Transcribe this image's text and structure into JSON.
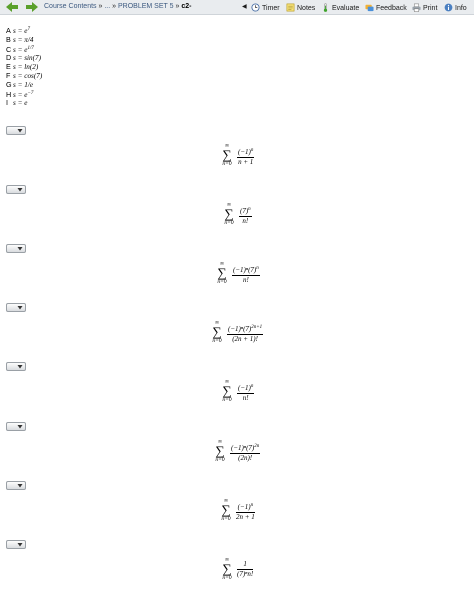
{
  "toolbar": {
    "breadcrumb_link": "Course Contents",
    "breadcrumb_sep1": "»",
    "breadcrumb_ellipsis": "...",
    "breadcrumb_sep2": "»",
    "breadcrumb_parent": "PROBLEM SET 5",
    "breadcrumb_sep3": "»",
    "breadcrumb_current": "c2-",
    "timer_label": "Timer",
    "notes_label": "Notes",
    "evaluate_label": "Evaluate",
    "feedback_label": "Feedback",
    "print_label": "Print",
    "info_label": "Info"
  },
  "options": [
    {
      "letter": "A",
      "lhs": "s = ",
      "base": "e",
      "sup": "7"
    },
    {
      "letter": "B",
      "lhs": "s = ",
      "base": "π/4",
      "sup": ""
    },
    {
      "letter": "C",
      "lhs": "s = ",
      "base": "e",
      "sup": "1/7"
    },
    {
      "letter": "D",
      "lhs": "s = ",
      "base": "sin(7)",
      "sup": ""
    },
    {
      "letter": "E",
      "lhs": "s = ",
      "base": "ln(2)",
      "sup": ""
    },
    {
      "letter": "F",
      "lhs": "s = ",
      "base": "cos(7)",
      "sup": ""
    },
    {
      "letter": "G",
      "lhs": "s = ",
      "base": "1/e",
      "sup": ""
    },
    {
      "letter": "H",
      "lhs": "s = ",
      "base": "e",
      "sup": "−7"
    },
    {
      "letter": "I",
      "lhs": "s = ",
      "base": "e",
      "sup": ""
    }
  ],
  "series": [
    {
      "upper": "∞",
      "lower": "n=0",
      "num": "(−1)",
      "num_sup": "n",
      "den": "n + 1",
      "den_sup": ""
    },
    {
      "upper": "∞",
      "lower": "n=0",
      "num": "(7)",
      "num_sup": "n",
      "den": "n!",
      "den_sup": ""
    },
    {
      "upper": "∞",
      "lower": "n=0",
      "num": "(−1)ⁿ(7)",
      "num_sup": "n",
      "den": "n!",
      "den_sup": ""
    },
    {
      "upper": "∞",
      "lower": "n=0",
      "num": "(−1)ⁿ(7)",
      "num_sup": "2n+1",
      "den": "(2n + 1)!",
      "den_sup": ""
    },
    {
      "upper": "∞",
      "lower": "n=0",
      "num": "(−1)",
      "num_sup": "n",
      "den": "n!",
      "den_sup": ""
    },
    {
      "upper": "∞",
      "lower": "n=0",
      "num": "(−1)ⁿ(7)",
      "num_sup": "2n",
      "den": "(2n)!",
      "den_sup": ""
    },
    {
      "upper": "∞",
      "lower": "n=0",
      "num": "(−1)",
      "num_sup": "n",
      "den": "2n + 1",
      "den_sup": ""
    },
    {
      "upper": "∞",
      "lower": "n=0",
      "num": "1",
      "num_sup": "",
      "den": "(7)ⁿn!",
      "den_sup": ""
    }
  ],
  "colors": {
    "toolbar_bg": "#e9ecef",
    "back_arrow": "#5aa02c",
    "forward_arrow": "#5aa02c",
    "link": "#3d5a80"
  },
  "icons": {
    "back": "back-arrow-icon",
    "forward": "forward-arrow-icon",
    "timer": "clock-icon",
    "notes": "notepad-icon",
    "evaluate": "thermometer-icon",
    "feedback": "feedback-icon",
    "print": "printer-icon",
    "info": "info-icon"
  }
}
